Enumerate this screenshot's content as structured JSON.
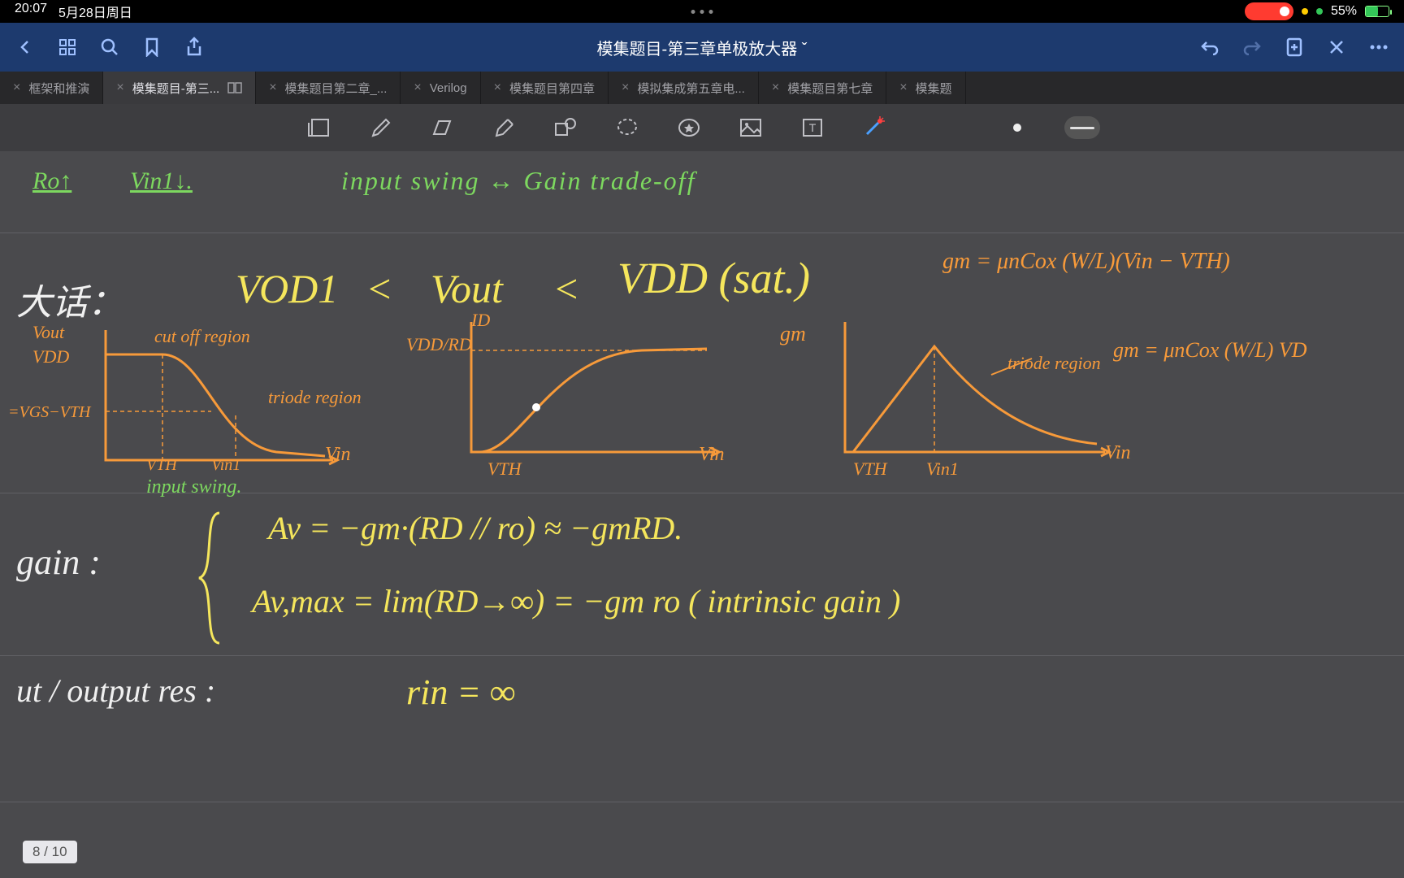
{
  "status": {
    "time": "20:07",
    "date": "5月28日周日",
    "battery": "55%"
  },
  "header": {
    "title": "模集题目-第三章单极放大器",
    "chevron": "ˇ"
  },
  "tabs": [
    {
      "label": "框架和推演",
      "active": false
    },
    {
      "label": "模集题目-第三...",
      "active": true
    },
    {
      "label": "模集题目第二章_...",
      "active": false
    },
    {
      "label": "Verilog",
      "active": false
    },
    {
      "label": "模集题目第四章",
      "active": false
    },
    {
      "label": "模拟集成第五章电...",
      "active": false
    },
    {
      "label": "模集题目第七章",
      "active": false
    },
    {
      "label": "模集题",
      "active": false
    }
  ],
  "page_indicator": "8 / 10",
  "notes": {
    "line1": {
      "ro": "Ro↑",
      "vin": "Vin1↓.",
      "swing": "input swing ↔ Gain   trade-off"
    },
    "cond_label": "大话：",
    "cond_ineq": {
      "l": "VOD1",
      "lt1": "<",
      "m": "Vout",
      "lt2": "<",
      "r": "VDD (sat.)"
    },
    "gm_eq1": "gm = μnCox (W/L)(Vin − VTH)",
    "gm_eq2": "gm = μnCox (W/L) VD",
    "graph1": {
      "ylab": "Vout",
      "ytick": "VDD",
      "ytick2": "=VGS−VTH",
      "cutoff": "cut off region",
      "triode": "triode region",
      "xlab": "Vin",
      "xt1": "VTH",
      "xt2": "Vin1",
      "swing": "input swing."
    },
    "graph2": {
      "title": "ID",
      "ytick": "VDD/RD",
      "xlab": "Vin",
      "xt": "VTH"
    },
    "graph3": {
      "ylab_left": "gm",
      "triode": "triode region",
      "xlab": "Vin",
      "xt1": "VTH",
      "xt2": "Vin1"
    },
    "gain_label": "gain :",
    "gain_eq1": "Av = −gm·(RD // ro) ≈ −gmRD.",
    "gain_eq2": "Av,max = lim(RD→∞) = −gm ro        ( intrinsic gain )",
    "res_label": "ut / output res :",
    "res_eq": "rin = ∞"
  }
}
